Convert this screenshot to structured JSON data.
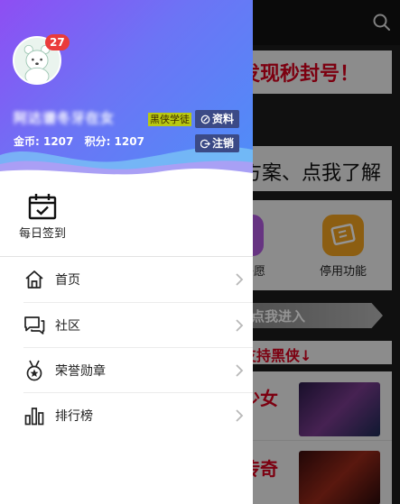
{
  "drawer": {
    "notification_count": "27",
    "username": "阿达谱冬牙在女",
    "level_tag": "黑侠学徒",
    "profile_button": "资料",
    "logout_button": "注销",
    "coins_label": "金币: 1207",
    "points_label": "积分: 1207",
    "checkin_label": "每日签到",
    "menu": [
      {
        "label": "首页",
        "icon": "home-icon"
      },
      {
        "label": "社区",
        "icon": "chat-icon"
      },
      {
        "label": "荣誉勋章",
        "icon": "medal-icon"
      },
      {
        "label": "排行榜",
        "icon": "bar-chart-icon"
      }
    ]
  },
  "background": {
    "notice_text": "发现秒封号！",
    "help_text": "方案、点我了解",
    "feature_left_label": "许愿",
    "feature_right_label": "停用功能",
    "enter_banner": "点我进入",
    "support_text": "支持黑侠↓",
    "list_titles": [
      "少女",
      "传奇"
    ]
  },
  "colors": {
    "header_gradient_start": "#8e4ef3",
    "header_gradient_end": "#4d8ff8",
    "badge": "#ea3b3b",
    "level_tag": "#b9c811",
    "header_button": "#3b4a86",
    "accent_red": "#d6001c"
  }
}
